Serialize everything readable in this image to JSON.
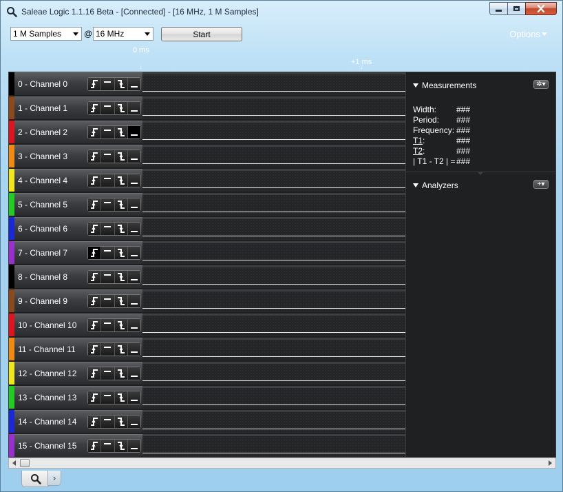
{
  "window": {
    "title": "Saleae Logic 1.1.16 Beta - [Connected] - [16 MHz, 1 M Samples]"
  },
  "toolbar": {
    "samples_value": "1 M Samples",
    "at_symbol": "@",
    "rate_value": "16 MHz",
    "start_label": "Start",
    "options_label": "Options"
  },
  "timeline": {
    "start_label": "0 ms",
    "marker_label": "+1 ms",
    "tick_glyph": "↓"
  },
  "channels": [
    {
      "name": "0 - Channel 0",
      "color": "#000000"
    },
    {
      "name": "1 - Channel 1",
      "color": "#8b4a1c"
    },
    {
      "name": "2 - Channel 2",
      "color": "#e0141e"
    },
    {
      "name": "3 - Channel 3",
      "color": "#f28a12"
    },
    {
      "name": "4 - Channel 4",
      "color": "#f0e61a"
    },
    {
      "name": "5 - Channel 5",
      "color": "#22cc22"
    },
    {
      "name": "6 - Channel 6",
      "color": "#1a28d8"
    },
    {
      "name": "7 - Channel 7",
      "color": "#9a2fd0"
    },
    {
      "name": "8 - Channel 8",
      "color": "#000000"
    },
    {
      "name": "9 - Channel 9",
      "color": "#8b4a1c"
    },
    {
      "name": "10 - Channel 10",
      "color": "#e0141e"
    },
    {
      "name": "11 - Channel 11",
      "color": "#f28a12"
    },
    {
      "name": "12 - Channel 12",
      "color": "#f0e61a"
    },
    {
      "name": "13 - Channel 13",
      "color": "#22cc22"
    },
    {
      "name": "14 - Channel 14",
      "color": "#1a28d8"
    },
    {
      "name": "15 - Channel 15",
      "color": "#9a2fd0"
    }
  ],
  "measurements": {
    "title": "Measurements",
    "rows": [
      {
        "key": "Width:",
        "value": "###",
        "underline": false
      },
      {
        "key": "Period:",
        "value": "###",
        "underline": false
      },
      {
        "key": "Frequency:",
        "value": "###",
        "underline": false
      },
      {
        "key": "T1",
        "suffix": ":",
        "value": "###",
        "underline": true
      },
      {
        "key": "T2",
        "suffix": ":",
        "value": "###",
        "underline": true
      },
      {
        "key": "| T1 - T2 | =",
        "value": "###",
        "underline": false
      }
    ]
  },
  "analyzers": {
    "title": "Analyzers",
    "add_glyph": "+▾"
  }
}
